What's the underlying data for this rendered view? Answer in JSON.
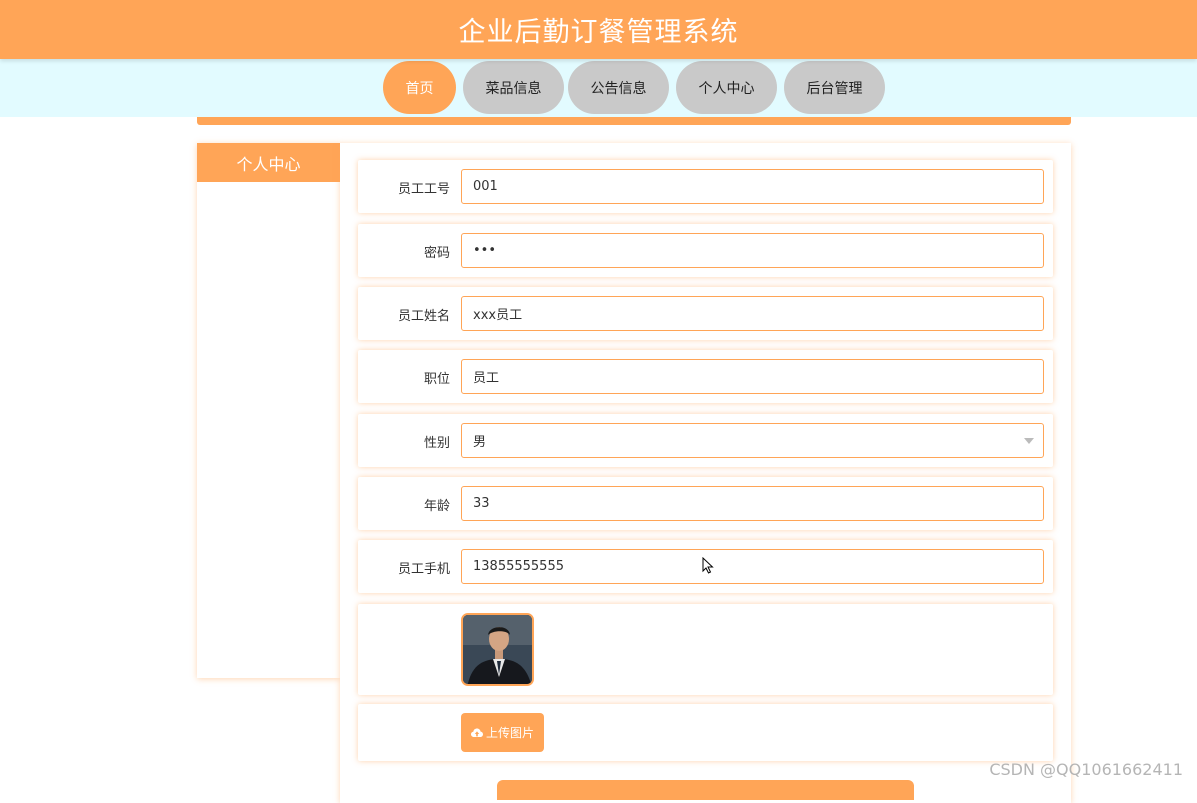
{
  "header": {
    "title": "企业后勤订餐管理系统"
  },
  "nav": {
    "items": [
      {
        "label": "首页"
      },
      {
        "label": "菜品信息"
      },
      {
        "label": "公告信息"
      },
      {
        "label": "个人中心"
      },
      {
        "label": "后台管理"
      }
    ],
    "active": "首页"
  },
  "sidebar": {
    "title": "个人中心"
  },
  "form": {
    "employee_id": {
      "label": "员工工号",
      "value": "001"
    },
    "password": {
      "label": "密码",
      "value": "•••"
    },
    "name": {
      "label": "员工姓名",
      "value": "xxx员工"
    },
    "position": {
      "label": "职位",
      "value": "员工"
    },
    "gender": {
      "label": "性别",
      "value": "男"
    },
    "age": {
      "label": "年龄",
      "value": "33"
    },
    "phone": {
      "label": "员工手机",
      "value": "13855555555"
    },
    "upload_label": "上传图片"
  },
  "watermark": "CSDN @QQ1061662411",
  "colors": {
    "accent": "#ffa557",
    "nav_bg": "#e2fbff",
    "nav_inactive": "#c9c9c9"
  },
  "icons": {
    "upload": "cloud-upload-icon",
    "select": "chevron-down-icon",
    "cursor": "mouse-pointer-icon"
  }
}
